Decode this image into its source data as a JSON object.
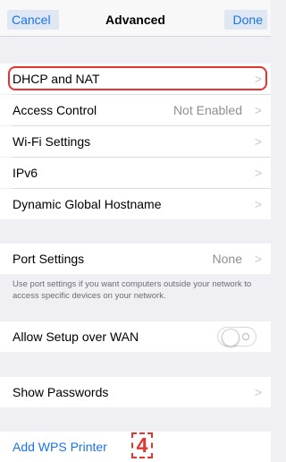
{
  "nav": {
    "cancel_label": "Cancel",
    "title": "Advanced",
    "done_label": "Done"
  },
  "rows": [
    {
      "label": "DHCP and NAT"
    },
    {
      "label": "Access Control",
      "value": "Not Enabled"
    },
    {
      "label": "Wi-Fi Settings"
    },
    {
      "label": "IPv6"
    },
    {
      "label": "Dynamic Global Hostname"
    }
  ],
  "port_settings": {
    "label": "Port Settings",
    "value": "None",
    "footnote": "Use port settings if you want computers outside your network to access specific devices on your network."
  },
  "allow_setup_wan": {
    "label": "Allow Setup over WAN",
    "enabled": false
  },
  "show_passwords": {
    "label": "Show Passwords"
  },
  "add_wps_printer": {
    "label": "Add WPS Printer"
  },
  "step_badge": "4",
  "colors": {
    "accent": "#1a74e8",
    "highlight": "#e3342f",
    "background": "#efeff4"
  },
  "icons": {
    "chevron": "chevron-right-icon",
    "toggle": "toggle-switch"
  }
}
